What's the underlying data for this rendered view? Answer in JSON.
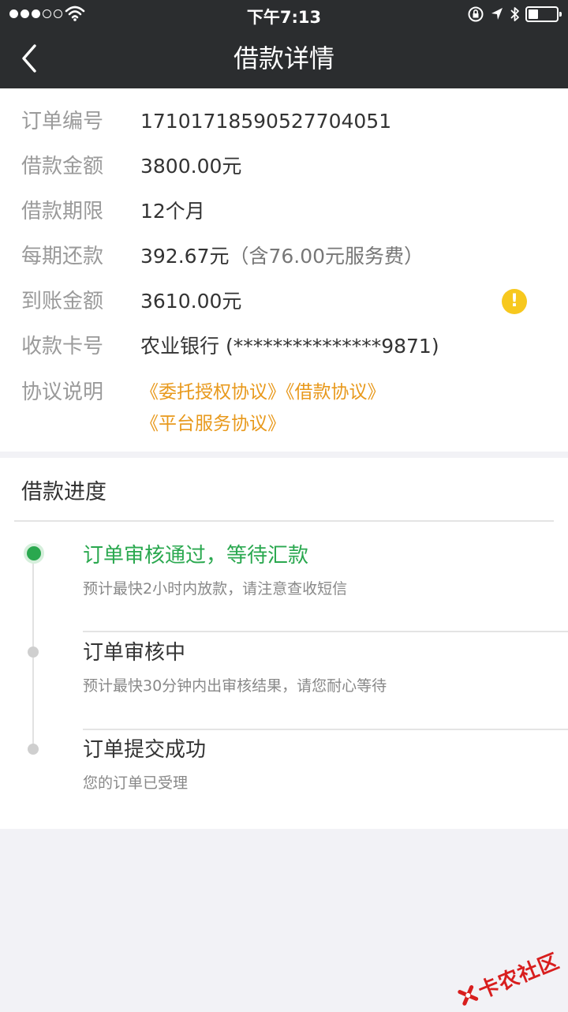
{
  "status_bar": {
    "time": "下午7:13",
    "signal_icon": "signal-dots-icon",
    "wifi_icon": "wifi-icon",
    "lock_icon": "orientation-lock-icon",
    "location_icon": "location-arrow-icon",
    "bluetooth_icon": "bluetooth-icon",
    "battery_icon": "battery-icon"
  },
  "nav": {
    "title": "借款详情",
    "back_icon": "back-chevron-icon"
  },
  "details": [
    {
      "label": "订单编号",
      "value": "171017185905277040​51"
    },
    {
      "label": "借款金额",
      "value": "3800.00元"
    },
    {
      "label": "借款期限",
      "value": "12个月"
    },
    {
      "label": "每期还款",
      "value": "392.67元",
      "sub": "（含76.00元服务费）"
    },
    {
      "label": "到账金额",
      "value": "3610.00元",
      "warn": "!"
    },
    {
      "label": "收款卡号",
      "value": "农业银行 (***************9871)"
    }
  ],
  "agreement": {
    "label": "协议说明",
    "links": [
      "《委托授权协议》",
      "《借款协议》",
      "《平台服务协议》"
    ]
  },
  "progress": {
    "title": "借款进度",
    "steps": [
      {
        "title": "订单审核通过，等待汇款",
        "desc": "预计最快2小时内放款，请注意查收短信"
      },
      {
        "title": "订单审核中",
        "desc": "预计最快30分钟内出审核结果，请您耐心等待"
      },
      {
        "title": "订单提交成功",
        "desc": "您的订单已受理"
      }
    ]
  },
  "watermark": {
    "text": "卡农社区"
  },
  "colors": {
    "topbar": "#2b2d2f",
    "accent_green": "#2aa84f",
    "link_orange": "#e8991c",
    "warning_yellow": "#f7c81e"
  }
}
